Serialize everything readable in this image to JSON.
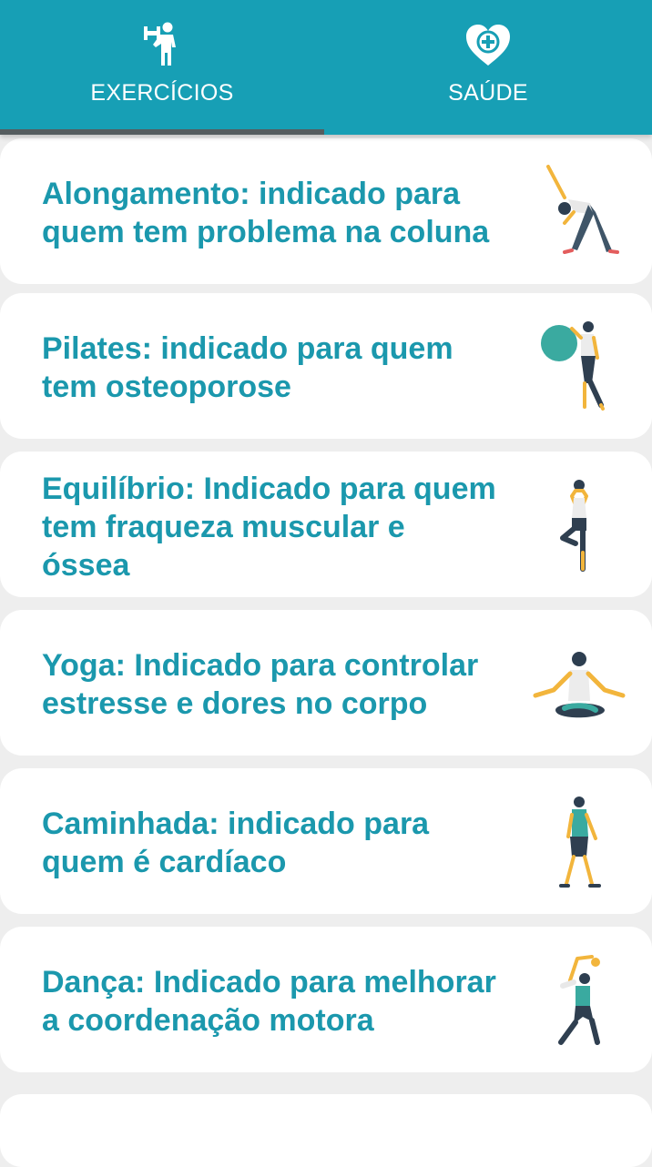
{
  "tabs": [
    {
      "label": "EXERCÍCIOS",
      "icon": "weightlifter-icon",
      "selected": true
    },
    {
      "label": "SAÚDE",
      "icon": "heart-plus-icon",
      "selected": false
    }
  ],
  "colors": {
    "primary": "#179fb5",
    "text": "#1b98ad",
    "indicator": "#555d5f",
    "background": "#eeeeee"
  },
  "exercises": [
    {
      "text": "Alongamento: indicado para quem tem problema na coluna",
      "icon": "stretching-figure-icon"
    },
    {
      "text": "Pilates: indicado para quem tem osteoporose",
      "icon": "pilates-ball-figure-icon"
    },
    {
      "text": "Equilíbrio: Indicado para quem tem fraqueza muscular e óssea",
      "icon": "tree-pose-figure-icon"
    },
    {
      "text": "Yoga: Indicado para controlar estresse e dores no corpo",
      "icon": "meditation-figure-icon"
    },
    {
      "text": "Caminhada: indicado para quem é cardíaco",
      "icon": "walking-figure-icon"
    },
    {
      "text": "Dança: Indicado para melhorar a coordenação motora",
      "icon": "dancing-figure-icon"
    }
  ]
}
